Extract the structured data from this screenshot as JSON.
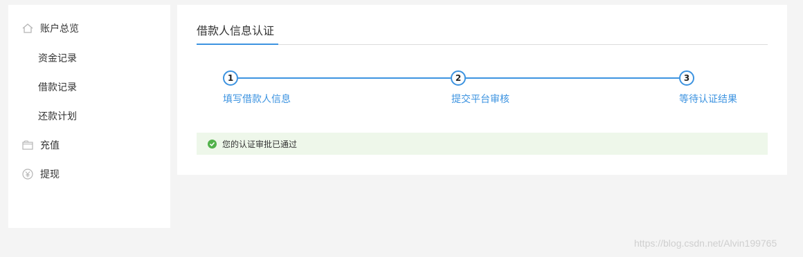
{
  "sidebar": {
    "items": [
      {
        "label": "账户总览",
        "icon": "home-icon"
      },
      {
        "label": "资金记录"
      },
      {
        "label": "借款记录"
      },
      {
        "label": "还款计划"
      },
      {
        "label": "充值",
        "icon": "wallet-icon"
      },
      {
        "label": "提现",
        "icon": "yen-icon"
      }
    ]
  },
  "main": {
    "title": "借款人信息认证",
    "steps": [
      {
        "number": "1",
        "label": "填写借款人信息"
      },
      {
        "number": "2",
        "label": "提交平台审核"
      },
      {
        "number": "3",
        "label": "等待认证结果"
      }
    ],
    "alert": {
      "text": "您的认证审批已通过",
      "icon": "check-circle-icon"
    }
  },
  "watermark": "https://blog.csdn.net/Alvin199765",
  "colors": {
    "accent": "#3c93e0",
    "success": "#52b24b",
    "alert_bg": "#eef7ea"
  }
}
